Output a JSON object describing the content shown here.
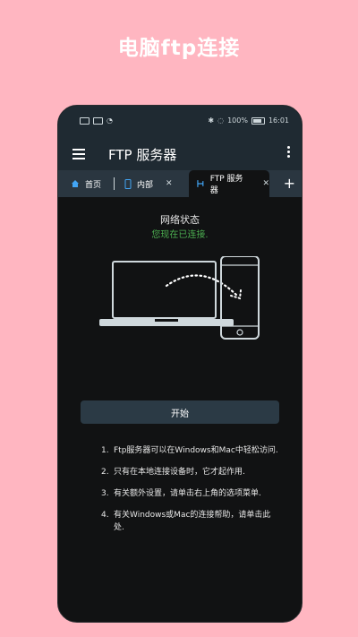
{
  "promo": {
    "title": "电脑ftp连接"
  },
  "status_bar": {
    "battery": "100%",
    "time": "16:01"
  },
  "app_bar": {
    "title": "FTP 服务器"
  },
  "tabs": [
    {
      "label": "首页",
      "icon": "home-icon",
      "closable": false
    },
    {
      "label": "内部",
      "icon": "phone-icon",
      "closable": true
    },
    {
      "label": "FTP 服务器",
      "icon": "network-icon",
      "closable": true,
      "active": true
    }
  ],
  "content": {
    "network_title": "网络状态",
    "network_status": "您现在已连接.",
    "start_button": "开始",
    "instructions": [
      {
        "num": "1.",
        "text": "Ftp服务器可以在Windows和Mac中轻松访问."
      },
      {
        "num": "2.",
        "text": "只有在本地连接设备时，它才起作用."
      },
      {
        "num": "3.",
        "text": "有关额外设置，请单击右上角的选项菜单."
      },
      {
        "num": "4.",
        "text": "有关Windows或Mac的连接帮助，请单击此处."
      }
    ]
  },
  "colors": {
    "background": "#ffb6c1",
    "bar": "#1f2a32",
    "status_green": "#4caf50",
    "button": "#2b3a45"
  }
}
